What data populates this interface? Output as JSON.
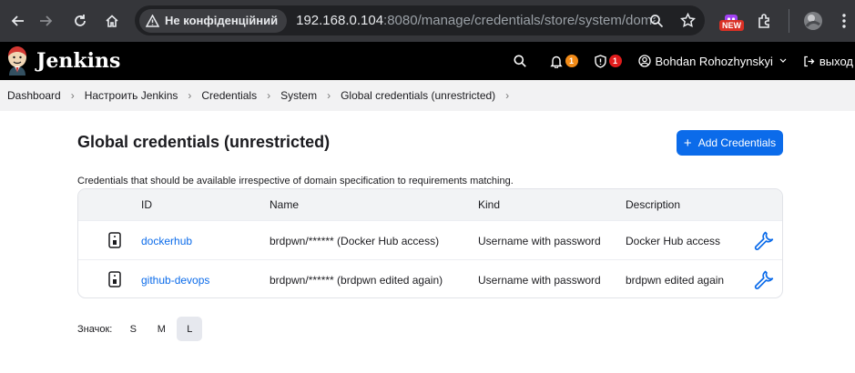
{
  "browser": {
    "security_label": "Не конфіденційний",
    "url_host": "192.168.0.104",
    "url_rest": ":8080/manage/credentials/store/system/domain...",
    "new_badge": "NEW"
  },
  "header": {
    "app_name": "Jenkins",
    "notifications_count": "1",
    "security_count": "1",
    "user_name": "Bohdan Rohozhynskyi",
    "logout_label": "выход"
  },
  "breadcrumbs": [
    "Dashboard",
    "Настроить Jenkins",
    "Credentials",
    "System",
    "Global credentials (unrestricted)"
  ],
  "page": {
    "title": "Global credentials (unrestricted)",
    "add_button_label": "Add Credentials",
    "description": "Credentials that should be available irrespective of domain specification to requirements matching."
  },
  "table": {
    "headers": {
      "id": "ID",
      "name": "Name",
      "kind": "Kind",
      "description": "Description"
    },
    "rows": [
      {
        "id": "dockerhub",
        "name": "brdpwn/****** (Docker Hub access)",
        "kind": "Username with password",
        "description": "Docker Hub access"
      },
      {
        "id": "github-devops",
        "name": "brdpwn/****** (brdpwn edited again)",
        "kind": "Username with password",
        "description": "brdpwn edited again"
      }
    ]
  },
  "icon_size": {
    "label": "Значок:",
    "options": [
      "S",
      "M",
      "L"
    ],
    "selected": "L"
  },
  "colors": {
    "accent": "#0b6bea",
    "header_bg": "#000000",
    "breadcrumb_bg": "#f2f2f3",
    "badge_orange": "#f28b18",
    "badge_red": "#e01c1c"
  }
}
